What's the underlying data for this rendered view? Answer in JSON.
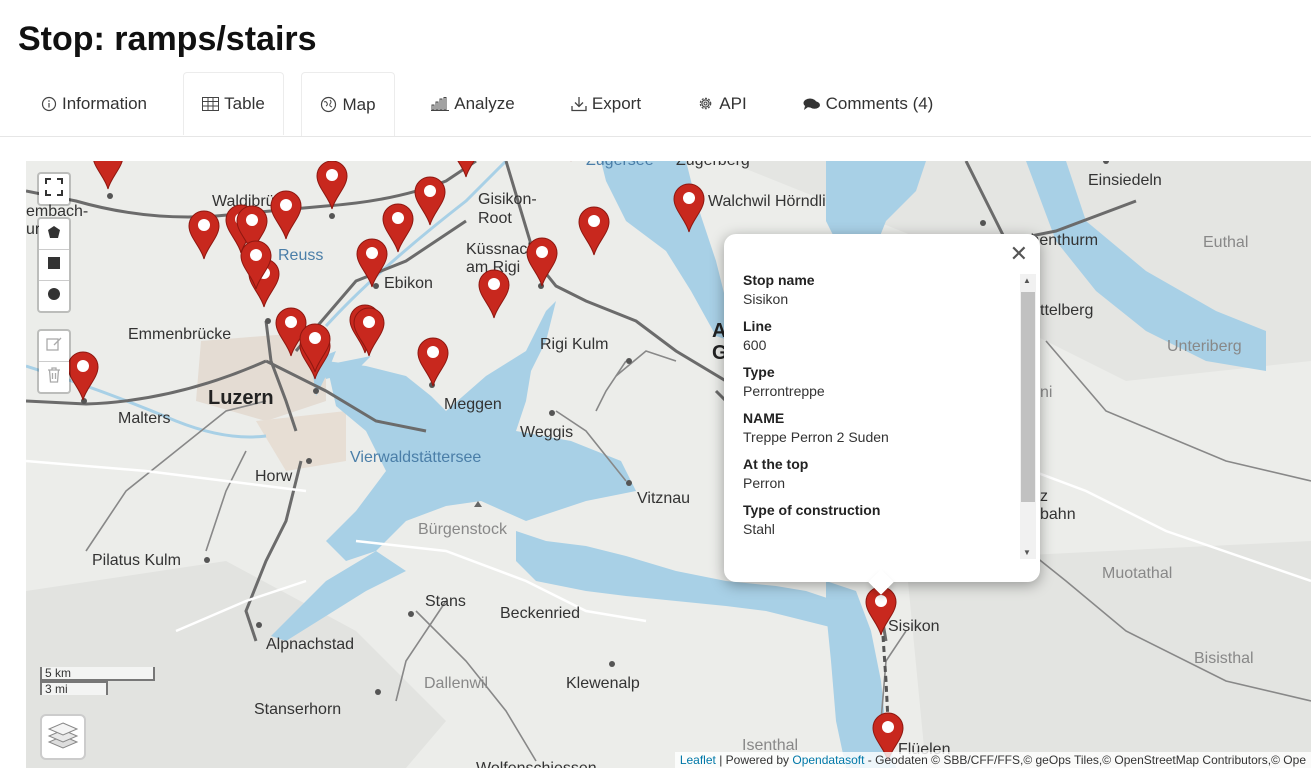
{
  "page": {
    "title": "Stop: ramps/stairs"
  },
  "tabs": [
    {
      "label": "Information",
      "icon": "info-circle-icon"
    },
    {
      "label": "Table",
      "icon": "table-icon"
    },
    {
      "label": "Map",
      "icon": "globe-icon",
      "active": true
    },
    {
      "label": "Analyze",
      "icon": "bar-chart-icon"
    },
    {
      "label": "Export",
      "icon": "download-icon"
    },
    {
      "label": "API",
      "icon": "gear-icon"
    },
    {
      "label": "Comments (4)",
      "icon": "comments-icon"
    }
  ],
  "map": {
    "labels": {
      "waldibrucke": "Waldibrücke",
      "gisikon_root_1": "Gisikon-",
      "gisikon_root_2": "Root",
      "zugersee": "Zugersee",
      "zugerberg": "Zugerberg",
      "einsiedeln": "Einsiedeln",
      "walchwil": "Walchwil Hörndli",
      "embach1": "embach-",
      "embach2": "urch",
      "reuss": "Reuss",
      "kussnacht1": "Küssnacht",
      "kussnacht2": "am Rigi",
      "rothenthurm": "thenthurm",
      "euthal": "Euthal",
      "ebikon": "Ebikon",
      "emmenbrucke": "Emmenbrücke",
      "rigi_kulm": "Rigi Kulm",
      "a_letter": "A",
      "g_letter": "G",
      "sattelberg": "ttelberg",
      "unteriberg": "Unteriberg",
      "malters": "Malters",
      "luzern": "Luzern",
      "meggen": "Meggen",
      "weggis": "Weggis",
      "ni": "ni",
      "vierwaldstattersee": "Vierwaldstättersee",
      "horw": "Horw",
      "vitznau": "Vitznau",
      "burgenstock": "Bürgenstock",
      "z": "z",
      "bahn": "bahn",
      "pilatus_kulm": "Pilatus Kulm",
      "muotathal": "Muotathal",
      "stans": "Stans",
      "beckenried": "Beckenried",
      "sisikon": "Sisikon",
      "alpnachstad": "Alpnachstad",
      "bisisthal": "Bisisthal",
      "dallenwil": "Dallenwil",
      "klewenalp": "Klewenalp",
      "stanserhorn": "Stanserhorn",
      "isenthal": "Isenthal",
      "fluelen": "Flüelen",
      "wolfenschiessen": "Wolfenschiessen"
    },
    "scale": {
      "km": "5 km",
      "mi": "3 mi"
    },
    "attribution": {
      "leaflet": "Leaflet",
      "powered_by": "Powered by",
      "opendatasoft": "Opendatasoft",
      "rest": "- Geodaten © SBB/CFF/FFS,© geOps Tiles,© OpenStreetMap Contributors,© Ope"
    },
    "colors": {
      "marker": "#c8281e",
      "water": "#a8d0e6",
      "land": "#ecedea"
    }
  },
  "popup": {
    "fields": [
      {
        "name": "Stop name",
        "value": "Sisikon"
      },
      {
        "name": "Line",
        "value": "600"
      },
      {
        "name": "Type",
        "value": "Perrontreppe"
      },
      {
        "name": "NAME",
        "value": "Treppe Perron 2 Suden"
      },
      {
        "name": "At the top",
        "value": "Perron"
      },
      {
        "name": "Type of construction",
        "value": "Stahl"
      }
    ]
  }
}
